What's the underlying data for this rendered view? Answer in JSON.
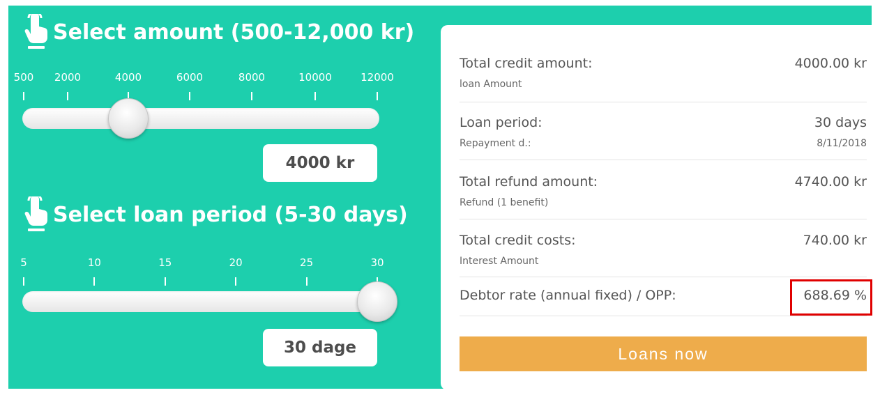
{
  "amount": {
    "title": "Select amount (500-12,000 kr)",
    "min": 500,
    "max": 12000,
    "value": 4000,
    "ticks": [
      "500",
      "2000",
      "4000",
      "6000",
      "8000",
      "10000",
      "12000"
    ],
    "value_label": "4000 kr"
  },
  "period": {
    "title": "Select loan period (5-30 days)",
    "min": 5,
    "max": 30,
    "value": 30,
    "ticks": [
      "5",
      "10",
      "15",
      "20",
      "25",
      "30"
    ],
    "value_label": "30 dage"
  },
  "summary": {
    "rows": [
      {
        "label": "Total credit amount:",
        "value": "4000.00 kr",
        "sub": "loan Amount",
        "subvalue": ""
      },
      {
        "label": "Loan period:",
        "value": "30 days",
        "sub": "Repayment d.:",
        "subvalue": "8/11/2018"
      },
      {
        "label": "Total refund amount:",
        "value": "4740.00 kr",
        "sub": "Refund (1 benefit)",
        "subvalue": ""
      },
      {
        "label": "Total credit costs:",
        "value": "740.00 kr",
        "sub": "Interest Amount",
        "subvalue": ""
      },
      {
        "label": "Debtor rate (annual fixed) / OPP:",
        "value": "688.69 %",
        "sub": "",
        "subvalue": ""
      }
    ],
    "cta_label": "Loans now"
  },
  "colors": {
    "background": "#1dcfad",
    "button": "#eeac4b",
    "highlight": "#e00000"
  },
  "icons": {
    "section_icon": "tap-hand-icon"
  }
}
